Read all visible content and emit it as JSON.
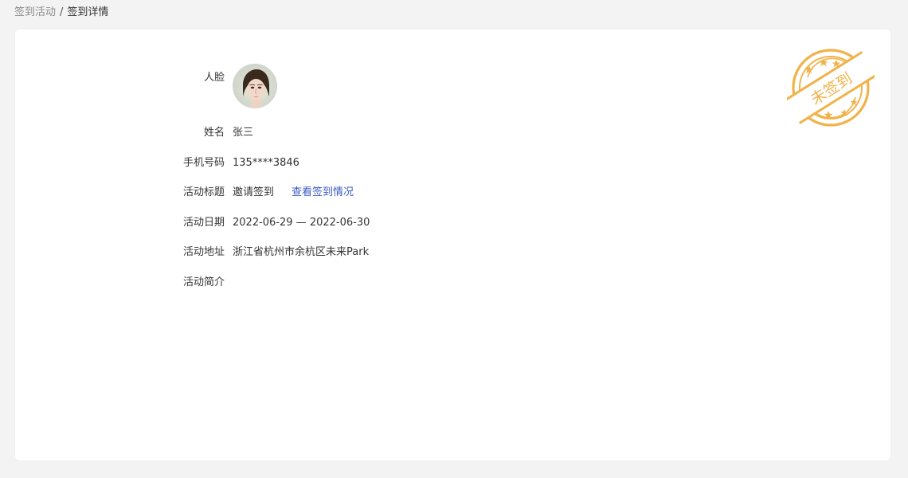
{
  "breadcrumb": {
    "parent": "签到活动",
    "separator": "/",
    "current": "签到详情"
  },
  "detail": {
    "face_label": "人脸",
    "name_label": "姓名",
    "name_value": "张三",
    "phone_label": "手机号码",
    "phone_value": "135****3846",
    "title_label": "活动标题",
    "title_value": "邀请签到",
    "view_link": "查看签到情况",
    "date_label": "活动日期",
    "date_value": "2022-06-29 — 2022-06-30",
    "address_label": "活动地址",
    "address_value": "浙江省杭州市余杭区未来Park",
    "intro_label": "活动简介",
    "intro_value": ""
  },
  "stamp": {
    "text": "未签到",
    "color": "#f1b24a"
  },
  "colors": {
    "page_bg": "#f3f3f3",
    "card_bg": "#ffffff",
    "link": "#3b5bc4",
    "text": "#333333",
    "muted": "#8c8c8c"
  },
  "icons": {
    "avatar": "user-face-photo",
    "stamp": "seal-stamp-icon"
  }
}
